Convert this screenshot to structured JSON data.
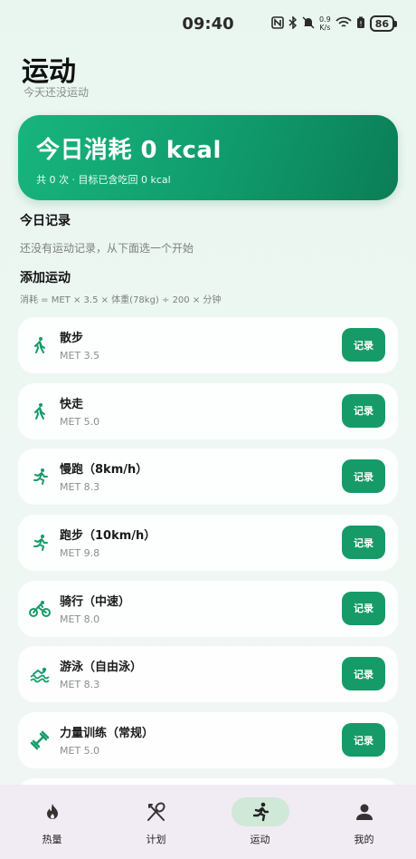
{
  "status": {
    "time": "09:40",
    "net_speed_value": "0.9",
    "net_speed_unit": "K/s",
    "battery": "86"
  },
  "header": {
    "title": "运动",
    "subtitle": "今天还没运动"
  },
  "summary": {
    "title": "今日消耗 0 kcal",
    "subtitle": "共 0 次 · 目标已含吃回 0 kcal"
  },
  "records": {
    "title": "今日记录",
    "empty_text": "还没有运动记录，从下面选一个开始"
  },
  "add": {
    "title": "添加运动",
    "formula": "消耗 = MET × 3.5 × 体重(78kg) ÷ 200 × 分钟"
  },
  "exercises": [
    {
      "name": "散步",
      "met": "MET 3.5",
      "icon": "walk-icon",
      "button": "记录"
    },
    {
      "name": "快走",
      "met": "MET 5.0",
      "icon": "walk-icon",
      "button": "记录"
    },
    {
      "name": "慢跑（8km/h）",
      "met": "MET 8.3",
      "icon": "run-icon",
      "button": "记录"
    },
    {
      "name": "跑步（10km/h）",
      "met": "MET 9.8",
      "icon": "run-icon",
      "button": "记录"
    },
    {
      "name": "骑行（中速）",
      "met": "MET 8.0",
      "icon": "bike-icon",
      "button": "记录"
    },
    {
      "name": "游泳（自由泳）",
      "met": "MET 8.3",
      "icon": "swim-icon",
      "button": "记录"
    },
    {
      "name": "力量训练（常规）",
      "met": "MET 5.0",
      "icon": "dumbbell-icon",
      "button": "记录"
    }
  ],
  "nav": {
    "items": [
      {
        "label": "热量",
        "icon": "flame-icon",
        "active": false
      },
      {
        "label": "计划",
        "icon": "utensils-icon",
        "active": false
      },
      {
        "label": "运动",
        "icon": "run-icon",
        "active": true
      },
      {
        "label": "我的",
        "icon": "person-icon",
        "active": false
      }
    ]
  },
  "colors": {
    "accent": "#169b68",
    "hero_start": "#18b57e",
    "hero_end": "#0b7d57",
    "nav_background": "#f1ebf3",
    "nav_active_pill": "#cfe8d8"
  }
}
